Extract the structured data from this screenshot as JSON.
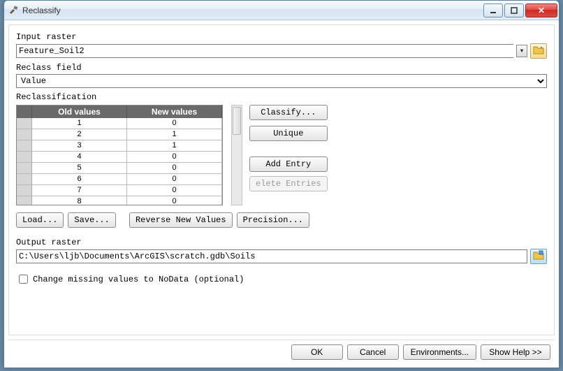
{
  "window": {
    "title": "Reclassify"
  },
  "labels": {
    "input_raster": "Input raster",
    "reclass_field": "Reclass field",
    "reclassification": "Reclassification",
    "output_raster": "Output raster",
    "change_missing": "Change missing values to NoData (optional)"
  },
  "values": {
    "input_raster": "Feature_Soil2",
    "reclass_field": "Value",
    "output_raster": "C:\\Users\\ljb\\Documents\\ArcGIS\\scratch.gdb\\Soils",
    "change_missing_checked": false
  },
  "table": {
    "headers": {
      "old": "Old values",
      "new": "New values"
    },
    "rows": [
      {
        "old": "1",
        "new": "0"
      },
      {
        "old": "2",
        "new": "1"
      },
      {
        "old": "3",
        "new": "1"
      },
      {
        "old": "4",
        "new": "0"
      },
      {
        "old": "5",
        "new": "0"
      },
      {
        "old": "6",
        "new": "0"
      },
      {
        "old": "7",
        "new": "0"
      },
      {
        "old": "8",
        "new": "0"
      }
    ]
  },
  "buttons": {
    "classify": "Classify...",
    "unique": "Unique",
    "add_entry": "Add Entry",
    "delete_entries": "elete Entries",
    "load": "Load...",
    "save": "Save...",
    "reverse": "Reverse New Values",
    "precision": "Precision...",
    "ok": "OK",
    "cancel": "Cancel",
    "environments": "Environments...",
    "show_help": "Show Help >>"
  },
  "icons": {
    "hammer": "hammer-icon",
    "folder_open": "folder-open-icon",
    "folder_save": "folder-save-icon"
  }
}
